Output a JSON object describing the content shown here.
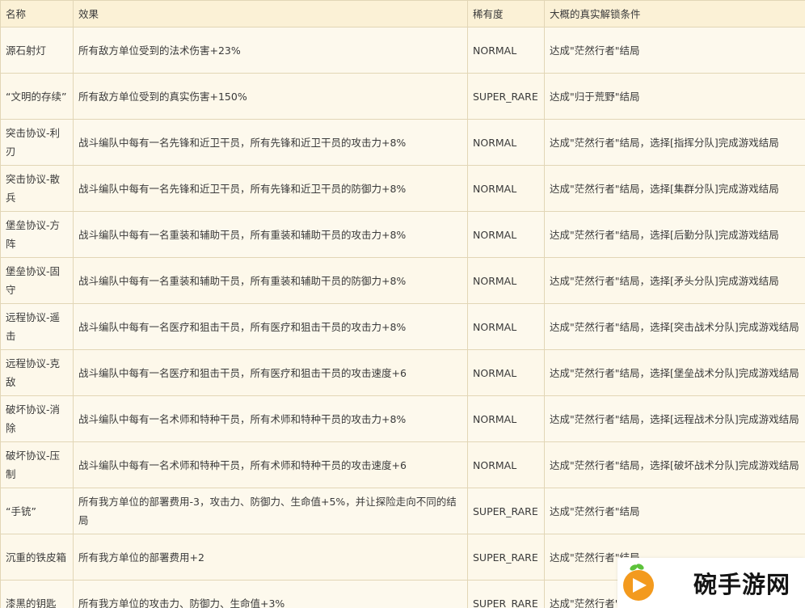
{
  "headers": {
    "name": "名称",
    "effect": "效果",
    "rarity": "稀有度",
    "unlock": "大概的真实解锁条件"
  },
  "rows": [
    {
      "name": "源石射灯",
      "effect": "所有敌方单位受到的法术伤害+23%",
      "rarity": "NORMAL",
      "unlock": "达成\"茫然行者\"结局"
    },
    {
      "name": "“文明的存续”",
      "effect": "所有敌方单位受到的真实伤害+150%",
      "rarity": "SUPER_RARE",
      "unlock": "达成\"归于荒野\"结局"
    },
    {
      "name": "突击协议-利刃",
      "effect": "战斗编队中每有一名先锋和近卫干员，所有先锋和近卫干员的攻击力+8%",
      "rarity": "NORMAL",
      "unlock": "达成\"茫然行者\"结局，选择[指挥分队]完成游戏结局"
    },
    {
      "name": "突击协议-散兵",
      "effect": "战斗编队中每有一名先锋和近卫干员，所有先锋和近卫干员的防御力+8%",
      "rarity": "NORMAL",
      "unlock": "达成\"茫然行者\"结局，选择[集群分队]完成游戏结局"
    },
    {
      "name": "堡垒协议-方阵",
      "effect": "战斗编队中每有一名重装和辅助干员，所有重装和辅助干员的攻击力+8%",
      "rarity": "NORMAL",
      "unlock": "达成\"茫然行者\"结局，选择[后勤分队]完成游戏结局"
    },
    {
      "name": "堡垒协议-固守",
      "effect": "战斗编队中每有一名重装和辅助干员，所有重装和辅助干员的防御力+8%",
      "rarity": "NORMAL",
      "unlock": "达成\"茫然行者\"结局，选择[矛头分队]完成游戏结局"
    },
    {
      "name": "远程协议-遥击",
      "effect": "战斗编队中每有一名医疗和狙击干员，所有医疗和狙击干员的攻击力+8%",
      "rarity": "NORMAL",
      "unlock": "达成\"茫然行者\"结局，选择[突击战术分队]完成游戏结局"
    },
    {
      "name": "远程协议-克敌",
      "effect": "战斗编队中每有一名医疗和狙击干员，所有医疗和狙击干员的攻击速度+6",
      "rarity": "NORMAL",
      "unlock": "达成\"茫然行者\"结局，选择[堡垒战术分队]完成游戏结局"
    },
    {
      "name": "破坏协议-消除",
      "effect": "战斗编队中每有一名术师和特种干员，所有术师和特种干员的攻击力+8%",
      "rarity": "NORMAL",
      "unlock": "达成\"茫然行者\"结局，选择[远程战术分队]完成游戏结局"
    },
    {
      "name": "破坏协议-压制",
      "effect": "战斗编队中每有一名术师和特种干员，所有术师和特种干员的攻击速度+6",
      "rarity": "NORMAL",
      "unlock": "达成\"茫然行者\"结局，选择[破坏战术分队]完成游戏结局"
    },
    {
      "name": "“手铳”",
      "effect": "所有我方单位的部署费用-3，攻击力、防御力、生命值+5%，并让探险走向不同的结局",
      "rarity": "SUPER_RARE",
      "unlock": "达成\"茫然行者\"结局"
    },
    {
      "name": "沉重的铁皮箱",
      "effect": "所有我方单位的部署费用+2",
      "rarity": "SUPER_RARE",
      "unlock": "达成\"茫然行者\"结局"
    },
    {
      "name": "漆黑的钥匙",
      "effect": "所有我方单位的攻击力、防御力、生命值+3%",
      "rarity": "SUPER_RARE",
      "unlock": "达成\"茫然行者\"结局"
    }
  ],
  "watermark": {
    "text": "碗手游网",
    "logo_icon": "play-bowl-logo-icon",
    "colors": {
      "orange": "#f39a1e",
      "green": "#5cc23a"
    }
  }
}
